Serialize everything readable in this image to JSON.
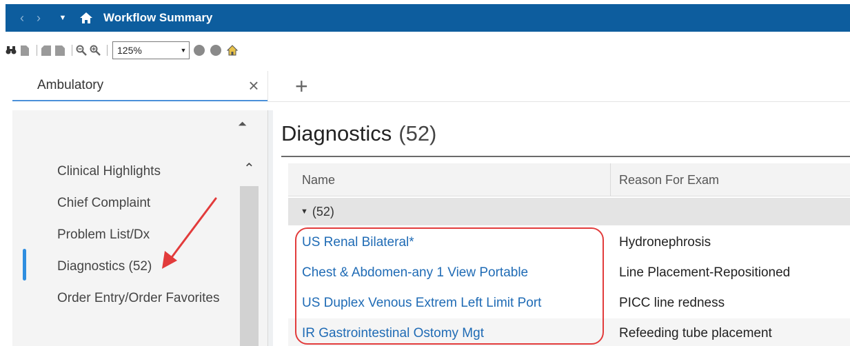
{
  "titlebar": {
    "title": "Workflow Summary",
    "back_icon": "chevron-left-icon",
    "forward_icon": "chevron-right-icon",
    "menu_icon": "caret-down-icon",
    "home_icon": "home-icon",
    "bg_color": "#0d5d9e"
  },
  "toolbar": {
    "zoom_value": "125%"
  },
  "tabs": {
    "active_label": "Ambulatory",
    "close_glyph": "×",
    "add_glyph": "+"
  },
  "sidebar": {
    "items": [
      {
        "label": "Clinical Highlights"
      },
      {
        "label": "Chief Complaint"
      },
      {
        "label": "Problem List/Dx"
      },
      {
        "label": "Diagnostics (52)"
      },
      {
        "label": "Order Entry/Order Favorites"
      }
    ],
    "active_index": 3,
    "accent_color": "#2f8ee0"
  },
  "main": {
    "title": "Diagnostics",
    "count": "(52)",
    "columns": {
      "name": "Name",
      "reason": "Reason For Exam"
    },
    "group_label": "(52)",
    "rows": [
      {
        "name": "US Renal Bilateral*",
        "reason": "Hydronephrosis"
      },
      {
        "name": "Chest & Abdomen-any 1 View Portable",
        "reason": "Line Placement-Repositioned"
      },
      {
        "name": "US Duplex Venous Extrem Left Limit Port",
        "reason": "PICC line redness"
      },
      {
        "name": "IR Gastrointestinal Ostomy Mgt",
        "reason": "Refeeding tube placement"
      }
    ],
    "link_color": "#1f6bb5",
    "annotation_color": "#e23b3b"
  }
}
